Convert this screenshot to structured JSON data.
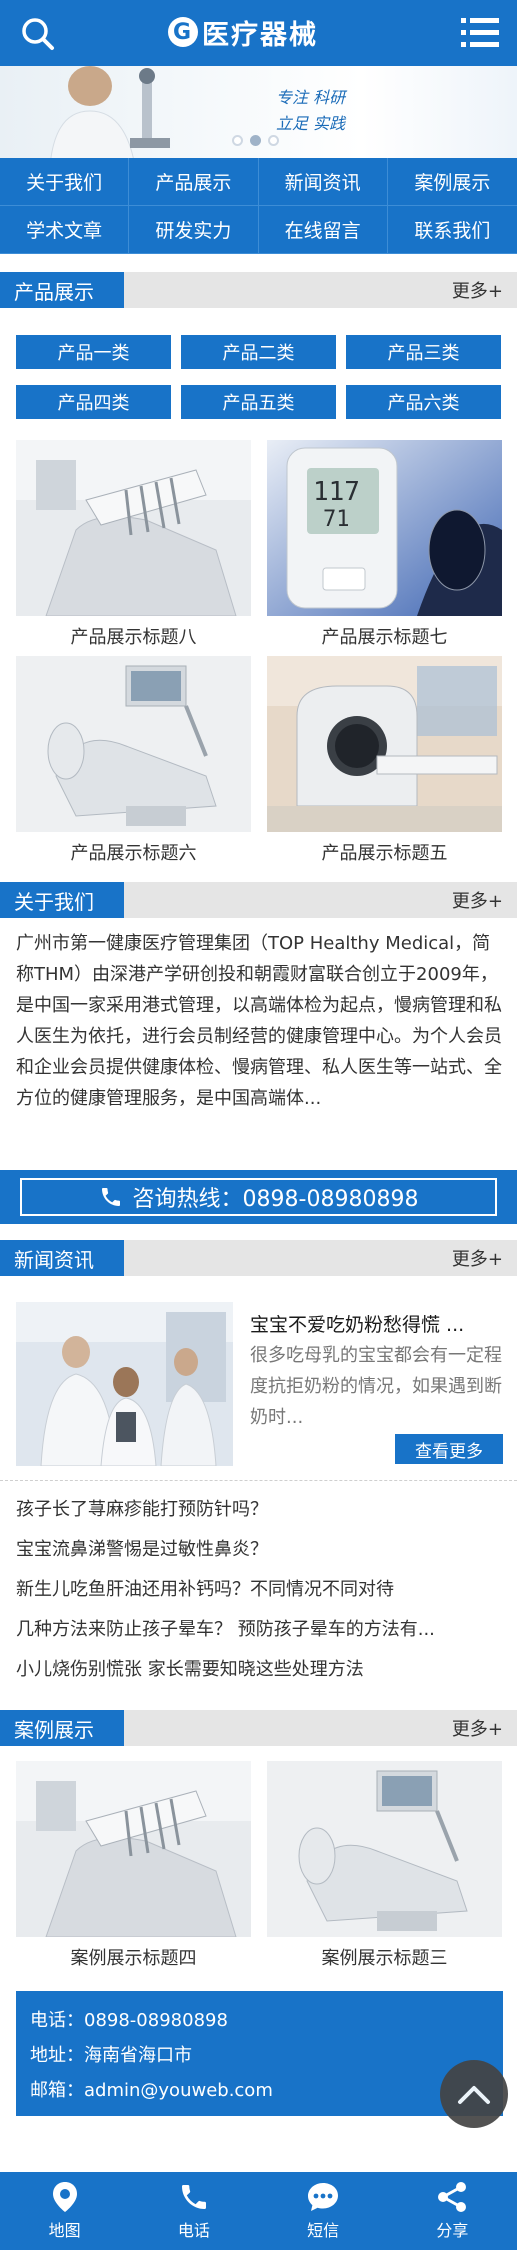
{
  "header": {
    "logo_mark": "G",
    "logo_text": "医疗器械",
    "icons": [
      "search-icon",
      "menu-icon"
    ]
  },
  "banner": {
    "slogan_line1": "专注 科研",
    "slogan_line2": "立足 实践",
    "active_dot": 1
  },
  "nav": [
    "关于我们",
    "产品展示",
    "新闻资讯",
    "案例展示",
    "学术文章",
    "研发实力",
    "在线留言",
    "联系我们"
  ],
  "products_section": {
    "title": "产品展示",
    "more": "更多+",
    "categories": [
      "产品一类",
      "产品二类",
      "产品三类",
      "产品四类",
      "产品五类",
      "产品六类"
    ],
    "items": [
      {
        "title": "产品展示标题八",
        "image": "dental-unit"
      },
      {
        "title": "产品展示标题七",
        "image": "blood-pressure-monitor"
      },
      {
        "title": "产品展示标题六",
        "image": "dental-chair"
      },
      {
        "title": "产品展示标题五",
        "image": "ct-scanner"
      }
    ]
  },
  "about_section": {
    "title": "关于我们",
    "more": "更多+",
    "text": "广州市第一健康医疗管理集团（TOP Healthy Medical，简称THM）由深港产学研创投和朝霞财富联合创立于2009年，是中国一家采用港式管理，以高端体检为起点，慢病管理和私人医生为依托，进行会员制经营的健康管理中心。为个人会员和企业会员提供健康体检、慢病管理、私人医生等一站式、全方位的健康管理服务，是中国高端体..."
  },
  "hotline": {
    "label": "咨询热线：0898-08980898"
  },
  "news_section": {
    "title": "新闻资讯",
    "more": "更多+",
    "featured": {
      "title": "宝宝不爱吃奶粉愁得慌 ...",
      "desc": "很多吃母乳的宝宝都会有一定程度抗拒奶粉的情况，如果遇到断奶时...",
      "button": "查看更多",
      "image": "lab-scientists"
    },
    "items": [
      "孩子长了荨麻疹能打预防针吗？",
      "宝宝流鼻涕警惕是过敏性鼻炎？",
      "新生儿吃鱼肝油还用补钙吗？不同情况不同对待",
      "几种方法来防止孩子晕车？ 预防孩子晕车的方法有...",
      "小儿烧伤别慌张 家长需要知晓这些处理方法"
    ]
  },
  "cases_section": {
    "title": "案例展示",
    "more": "更多+",
    "items": [
      {
        "title": "案例展示标题四",
        "image": "dental-unit"
      },
      {
        "title": "案例展示标题三",
        "image": "dental-chair"
      }
    ]
  },
  "contact": {
    "phone": "电话：0898-08980898",
    "address": "地址：海南省海口市",
    "email": "邮箱：admin@youweb.com"
  },
  "bottom_bar": [
    {
      "label": "地图",
      "icon": "map-pin-icon"
    },
    {
      "label": "电话",
      "icon": "phone-icon"
    },
    {
      "label": "短信",
      "icon": "message-icon"
    },
    {
      "label": "分享",
      "icon": "share-icon"
    }
  ],
  "colors": {
    "primary": "#1873c8",
    "section_bar": "#e5e5e5",
    "totop": "#444444"
  }
}
